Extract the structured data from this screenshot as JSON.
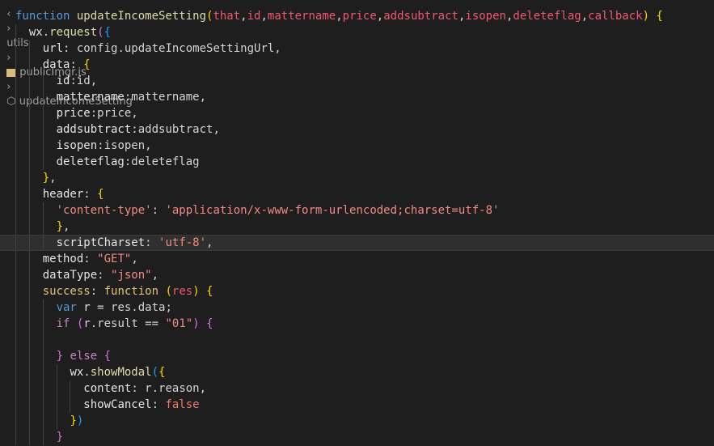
{
  "breadcrumb": {
    "folder": "utils",
    "file": "publicImgr.js",
    "symbol": "updateIncomeSetting"
  },
  "editor": {
    "current_line_index": 14,
    "lines": [
      [
        [
          "kw",
          "function "
        ],
        [
          "fn",
          "updateIncomeSetting"
        ],
        [
          "p1",
          "("
        ],
        [
          "param",
          "that"
        ],
        [
          "plain",
          ","
        ],
        [
          "param",
          "id"
        ],
        [
          "plain",
          ","
        ],
        [
          "param",
          "mattername"
        ],
        [
          "plain",
          ","
        ],
        [
          "param",
          "price"
        ],
        [
          "plain",
          ","
        ],
        [
          "param",
          "addsubtract"
        ],
        [
          "plain",
          ","
        ],
        [
          "param",
          "isopen"
        ],
        [
          "plain",
          ","
        ],
        [
          "param",
          "deleteflag"
        ],
        [
          "plain",
          ","
        ],
        [
          "param",
          "callback"
        ],
        [
          "p1",
          ")"
        ],
        [
          "plain",
          " "
        ],
        [
          "p1",
          "{"
        ]
      ],
      [
        [
          "plain",
          "  "
        ],
        [
          "prop",
          "wx"
        ],
        [
          "plain",
          "."
        ],
        [
          "fn",
          "request"
        ],
        [
          "p2",
          "("
        ],
        [
          "p3",
          "{"
        ]
      ],
      [
        [
          "plain",
          "    "
        ],
        [
          "prop",
          "url"
        ],
        [
          "plain",
          ": config.updateIncomeSettingUrl,"
        ]
      ],
      [
        [
          "plain",
          "    "
        ],
        [
          "prop",
          "data"
        ],
        [
          "plain",
          ": "
        ],
        [
          "p1",
          "{"
        ]
      ],
      [
        [
          "plain",
          "      "
        ],
        [
          "prop",
          "id"
        ],
        [
          "plain",
          ":id,"
        ]
      ],
      [
        [
          "plain",
          "      "
        ],
        [
          "prop",
          "mattername"
        ],
        [
          "plain",
          ":mattername,"
        ]
      ],
      [
        [
          "plain",
          "      "
        ],
        [
          "prop",
          "price"
        ],
        [
          "plain",
          ":price,"
        ]
      ],
      [
        [
          "plain",
          "      "
        ],
        [
          "prop",
          "addsubtract"
        ],
        [
          "plain",
          ":addsubtract,"
        ]
      ],
      [
        [
          "plain",
          "      "
        ],
        [
          "prop",
          "isopen"
        ],
        [
          "plain",
          ":isopen,"
        ]
      ],
      [
        [
          "plain",
          "      "
        ],
        [
          "prop",
          "deleteflag"
        ],
        [
          "plain",
          ":deleteflag"
        ]
      ],
      [
        [
          "plain",
          "    "
        ],
        [
          "p1",
          "}"
        ],
        [
          "plain",
          ","
        ]
      ],
      [
        [
          "plain",
          "    "
        ],
        [
          "prop",
          "header"
        ],
        [
          "plain",
          ": "
        ],
        [
          "p1",
          "{"
        ]
      ],
      [
        [
          "plain",
          "      "
        ],
        [
          "str",
          "'content-type'"
        ],
        [
          "plain",
          ": "
        ],
        [
          "str",
          "'application/x-www-form-urlencoded;charset=utf-8'"
        ]
      ],
      [
        [
          "plain",
          "      "
        ],
        [
          "p1",
          "}"
        ],
        [
          "plain",
          ","
        ]
      ],
      [
        [
          "plain",
          "      "
        ],
        [
          "prop",
          "scriptCharset"
        ],
        [
          "plain",
          ": "
        ],
        [
          "str",
          "'utf-8'"
        ],
        [
          "plain",
          ","
        ]
      ],
      [
        [
          "plain",
          "    "
        ],
        [
          "prop",
          "method"
        ],
        [
          "plain",
          ": "
        ],
        [
          "str",
          "\"GET\""
        ],
        [
          "plain",
          ","
        ]
      ],
      [
        [
          "plain",
          "    "
        ],
        [
          "prop",
          "dataType"
        ],
        [
          "plain",
          ": "
        ],
        [
          "str",
          "\"json\""
        ],
        [
          "plain",
          ","
        ]
      ],
      [
        [
          "plain",
          "    "
        ],
        [
          "fn2",
          "success"
        ],
        [
          "plain",
          ": "
        ],
        [
          "fn2",
          "function"
        ],
        [
          "plain",
          " "
        ],
        [
          "p1",
          "("
        ],
        [
          "param",
          "res"
        ],
        [
          "p1",
          ")"
        ],
        [
          "plain",
          " "
        ],
        [
          "p1",
          "{"
        ]
      ],
      [
        [
          "plain",
          "      "
        ],
        [
          "kw",
          "var "
        ],
        [
          "prop",
          "r"
        ],
        [
          "plain",
          " = res.data;"
        ]
      ],
      [
        [
          "plain",
          "      "
        ],
        [
          "ctl",
          "if"
        ],
        [
          "plain",
          " "
        ],
        [
          "p2",
          "("
        ],
        [
          "plain",
          "r.result == "
        ],
        [
          "str",
          "\"01\""
        ],
        [
          "p2",
          ")"
        ],
        [
          "plain",
          " "
        ],
        [
          "p2",
          "{"
        ]
      ],
      [
        [
          "plain",
          ""
        ]
      ],
      [
        [
          "plain",
          "      "
        ],
        [
          "p2",
          "}"
        ],
        [
          "plain",
          " "
        ],
        [
          "ctl",
          "else"
        ],
        [
          "plain",
          " "
        ],
        [
          "p2",
          "{"
        ]
      ],
      [
        [
          "plain",
          "        "
        ],
        [
          "prop",
          "wx"
        ],
        [
          "plain",
          "."
        ],
        [
          "fn",
          "showModal"
        ],
        [
          "p3",
          "("
        ],
        [
          "p1",
          "{"
        ]
      ],
      [
        [
          "plain",
          "          "
        ],
        [
          "prop",
          "content"
        ],
        [
          "plain",
          ": r.reason,"
        ]
      ],
      [
        [
          "plain",
          "          "
        ],
        [
          "prop",
          "showCancel"
        ],
        [
          "plain",
          ": "
        ],
        [
          "str2",
          "false"
        ]
      ],
      [
        [
          "plain",
          "        "
        ],
        [
          "p1",
          "}"
        ],
        [
          "p3",
          ")"
        ]
      ],
      [
        [
          "plain",
          "      "
        ],
        [
          "p2",
          "}"
        ]
      ]
    ]
  }
}
